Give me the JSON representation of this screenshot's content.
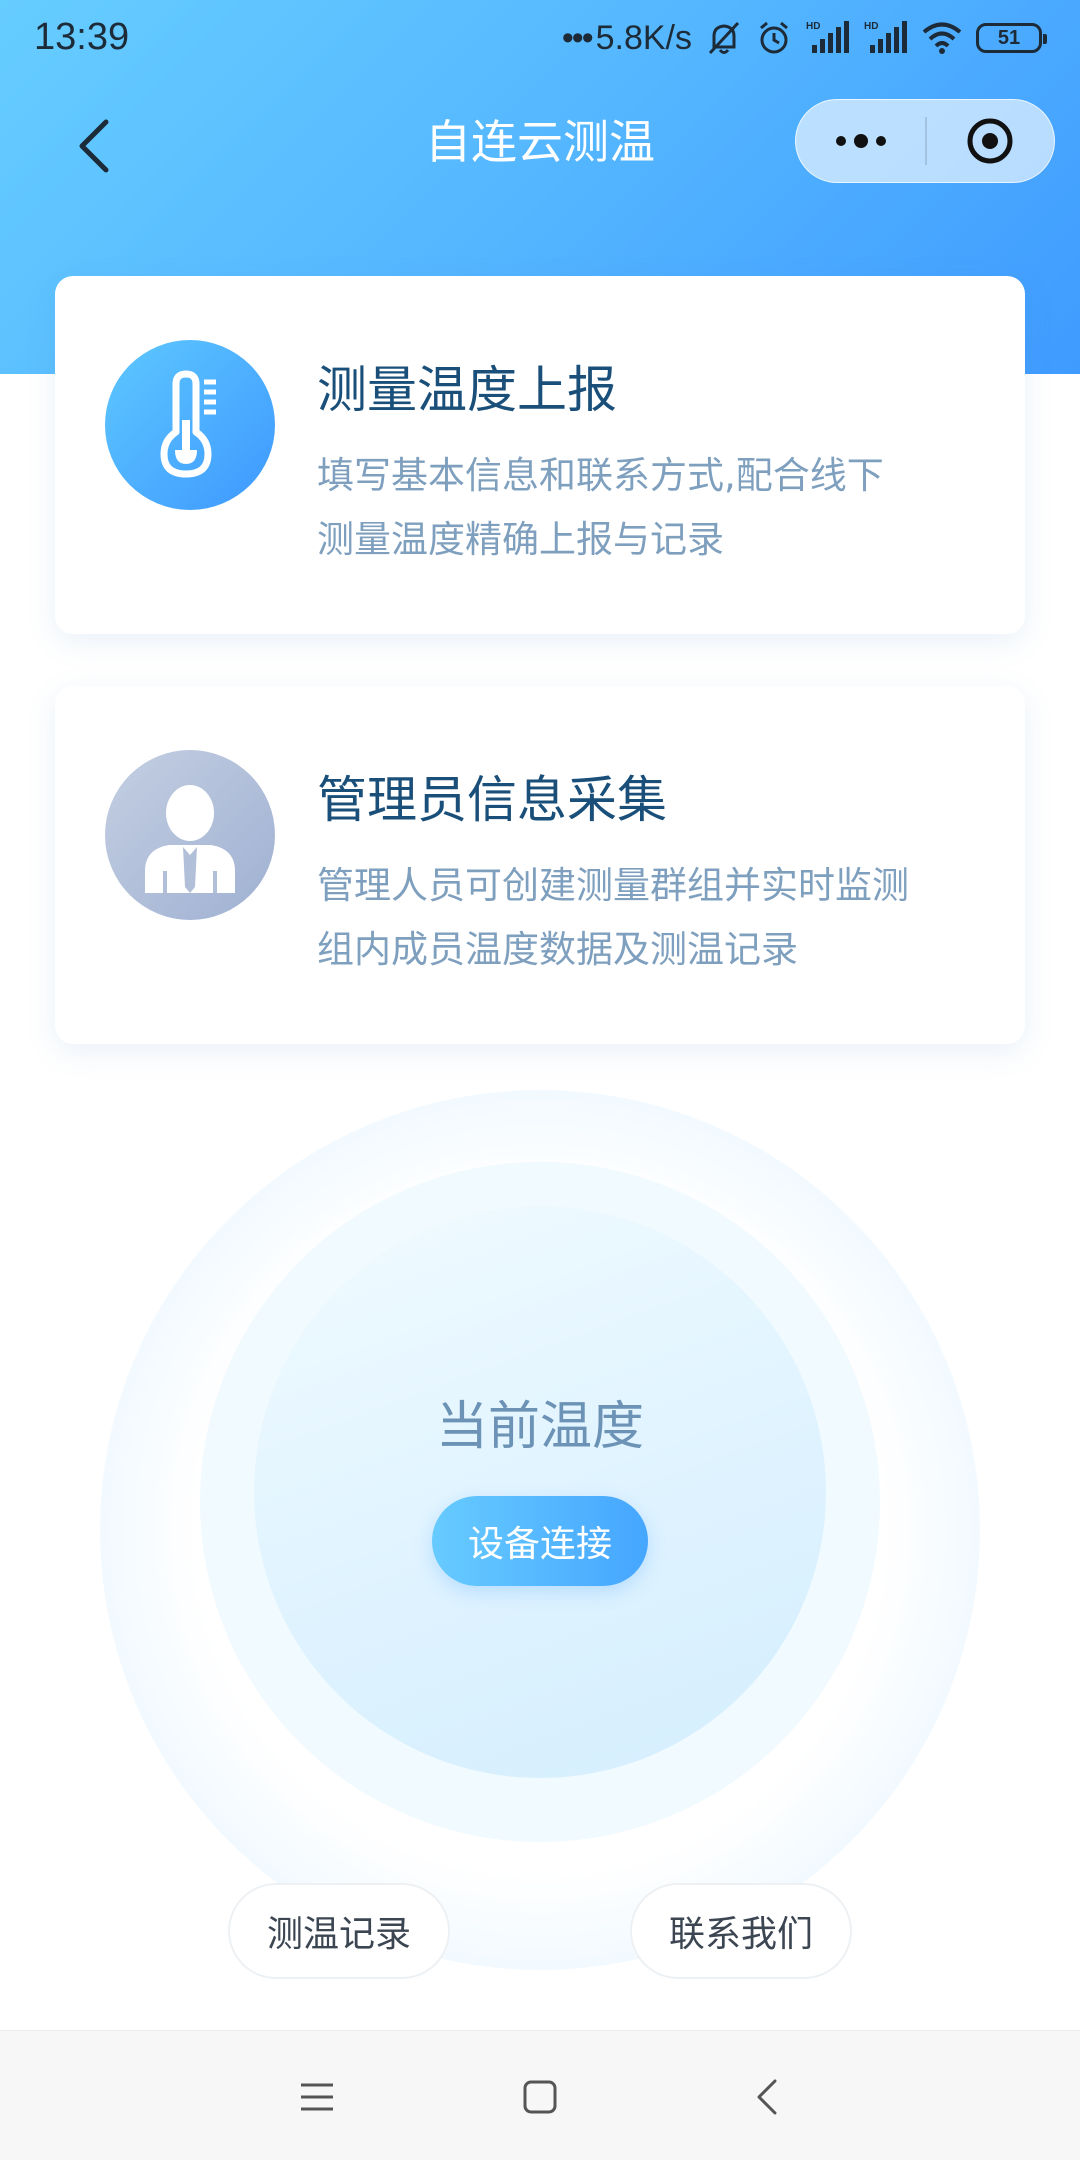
{
  "status_bar": {
    "time": "13:39",
    "net_dots": "•••",
    "net_speed": "5.8K/s",
    "battery": "51",
    "icons": [
      "mute-bell-icon",
      "alarm-clock-icon",
      "hd-signal-icon",
      "hd-signal-icon",
      "wifi-icon",
      "battery-icon"
    ]
  },
  "nav": {
    "title": "自连云测温",
    "back_icon": "chevron-left-icon",
    "more_icon": "more-dots-icon",
    "close_icon": "target-circle-icon"
  },
  "cards": [
    {
      "icon": "thermometer-icon",
      "title": "测量温度上报",
      "desc_line1": "填写基本信息和联系方式,配合线下",
      "desc_line2": "测量温度精确上报与记录"
    },
    {
      "icon": "admin-user-icon",
      "title": "管理员信息采集",
      "desc_line1": "管理人员可创建测量群组并实时监测",
      "desc_line2": "组内成员温度数据及测温记录"
    }
  ],
  "temperature": {
    "label": "当前温度",
    "connect_button": "设备连接"
  },
  "bottom_buttons": {
    "records": "测温记录",
    "contact": "联系我们"
  },
  "system_nav": {
    "menu_icon": "menu-lines-icon",
    "home_icon": "square-home-icon",
    "back_icon": "chevron-left-icon"
  },
  "colors": {
    "header_gradient_start": "#66cdff",
    "header_gradient_end": "#3f9bff",
    "card_title": "#1a4f7a",
    "card_desc": "#7e9fbe",
    "accent_blue": "#45a6ff"
  }
}
